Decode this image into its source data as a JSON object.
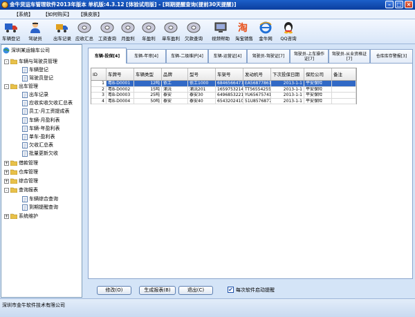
{
  "window": {
    "title": "金牛货运车管理软件2013年版本  单机版:4.3.12 [体验试用版] - [到期提醒查询(提前30天提醒)]"
  },
  "menu": [
    "【系统】",
    "【如何购买】",
    "【换皮肤】"
  ],
  "toolbar": [
    {
      "label": "车辆登记",
      "icon": "truck-icon"
    },
    {
      "label": "驾驶员",
      "icon": "driver-icon"
    },
    {
      "label": "出车记录",
      "icon": "dispatch-truck-icon"
    },
    {
      "label": "应收汇总",
      "icon": "cd-icon"
    },
    {
      "label": "工资查询",
      "icon": "cd-icon"
    },
    {
      "label": "月盈利",
      "icon": "cd-icon"
    },
    {
      "label": "年盈利",
      "icon": "cd-icon"
    },
    {
      "label": "单车盈利",
      "icon": "cd-icon"
    },
    {
      "label": "欠款查询",
      "icon": "cd-icon"
    },
    {
      "label": "视频帮助",
      "icon": "video-icon"
    },
    {
      "label": "淘宝销售",
      "icon": "taobao-icon"
    },
    {
      "label": "金牛网",
      "icon": "ie-icon"
    },
    {
      "label": "QQ咨询",
      "icon": "qq-icon"
    }
  ],
  "tree": {
    "root": "深圳某运输车公司",
    "nodes": [
      {
        "label": "车辆与驾驶员管理",
        "type": "folder",
        "expander": "-",
        "level": 1
      },
      {
        "label": "车辆登记",
        "type": "item",
        "level": 2
      },
      {
        "label": "驾驶员登记",
        "type": "item",
        "level": 2
      },
      {
        "label": "出车管理",
        "type": "folder",
        "expander": "-",
        "level": 1
      },
      {
        "label": "出车记录",
        "type": "item",
        "level": 2
      },
      {
        "label": "应收实收欠收汇总表",
        "type": "item",
        "level": 2
      },
      {
        "label": "员工-月工资提成表",
        "type": "item",
        "level": 2
      },
      {
        "label": "车辆-月盈利表",
        "type": "item",
        "level": 2
      },
      {
        "label": "车辆-年盈利表",
        "type": "item",
        "level": 2
      },
      {
        "label": "单车-盈利表",
        "type": "item",
        "level": 2
      },
      {
        "label": "欠收汇总表",
        "type": "item",
        "level": 2
      },
      {
        "label": "批量更新欠收",
        "type": "item",
        "level": 2
      },
      {
        "label": "借款管理",
        "type": "folder",
        "expander": "+",
        "level": 1
      },
      {
        "label": "仓库管理",
        "type": "folder",
        "expander": "+",
        "level": 1
      },
      {
        "label": "综合管理",
        "type": "folder",
        "expander": "+",
        "level": 1
      },
      {
        "label": "查询报表",
        "type": "folder",
        "expander": "-",
        "level": 1
      },
      {
        "label": "车辆综合查询",
        "type": "item",
        "level": 2
      },
      {
        "label": "到期提醒查询",
        "type": "item",
        "level": 2
      },
      {
        "label": "系统维护",
        "type": "folder",
        "expander": "+",
        "level": 1
      }
    ]
  },
  "tabs": [
    "车辆-投保[4]",
    "车辆-年审[4]",
    "车辆-二级维护[4]",
    "车辆-运营证[4]",
    "驾驶员-驾驶证[7]",
    "驾驶员-上车操作证[7]",
    "驾驶员-从业资格证[7]",
    "仓库库存警报[3]"
  ],
  "grid": {
    "columns": [
      "ID",
      "车牌号",
      "车辆类型",
      "品牌",
      "型号",
      "车架号",
      "发动机号",
      "下次投保日期",
      "保险公司",
      "备注"
    ],
    "rows": [
      [
        "1",
        "粤B-D0001",
        "12吨",
        "依工",
        "依工1000",
        "6846566477",
        "EA56877861",
        "2013-1-1",
        "平安保险",
        ""
      ],
      [
        "2",
        "粤B-D0002",
        "15吨",
        "浦沅",
        "浦沅201",
        "1659753214",
        "TT56554255",
        "2013-1-1",
        "平安保险",
        ""
      ],
      [
        "3",
        "粤B-D0003",
        "25吨",
        "泰安",
        "泰安30",
        "6496853221",
        "YU65675741",
        "2013-1-1",
        "平安保险",
        ""
      ],
      [
        "4",
        "粤B-D0004",
        "50吨",
        "泰安",
        "泰安40",
        "6543202410",
        "51U8576877",
        "2013-1-1",
        "平安保险",
        ""
      ]
    ],
    "selected_row": 0
  },
  "buttons": {
    "edit": "修改(O)",
    "report": "生成报表(B)",
    "exit": "退出(C)"
  },
  "checkbox": {
    "label": "每次软件启动提醒",
    "checked": true
  },
  "status": "深圳市金牛软件技术有限公司",
  "colors": {
    "selection": "#3169c6",
    "titlebar": "#1c5fc9"
  }
}
